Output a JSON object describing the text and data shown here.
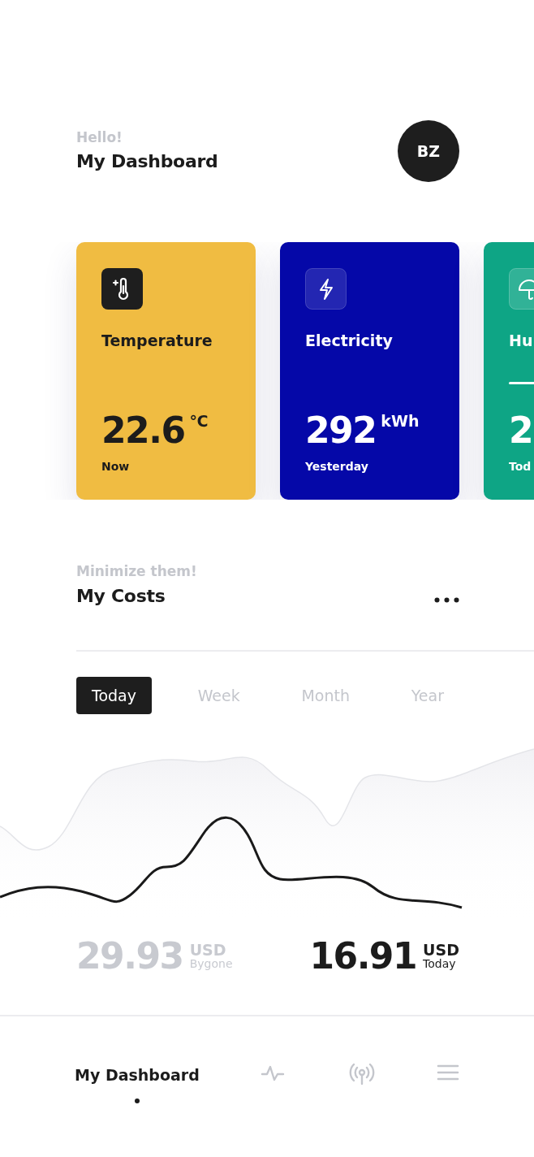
{
  "header": {
    "greeting": "Hello!",
    "title": "My Dashboard",
    "avatar": "BZ"
  },
  "cards": [
    {
      "kind": "temperature",
      "title": "Temperature",
      "value": "22.6",
      "unit": "℃",
      "caption": "Now",
      "color": "#f0bc42"
    },
    {
      "kind": "electricity",
      "title": "Electricity",
      "value": "292",
      "unit": "kWh",
      "caption": "Yesterday",
      "color": "#0508a8"
    },
    {
      "kind": "humidity",
      "title": "Hu",
      "value": "2",
      "caption": "Tod",
      "color": "#0ea585"
    }
  ],
  "costs": {
    "subtitle": "Minimize them!",
    "title": "My Costs"
  },
  "periods": [
    {
      "label": "Today",
      "selected": true
    },
    {
      "label": "Week",
      "selected": false
    },
    {
      "label": "Month",
      "selected": false
    },
    {
      "label": "Year",
      "selected": false
    }
  ],
  "totals": [
    {
      "kind": "past",
      "value": "29.93",
      "currency": "USD",
      "caption": "Bygone"
    },
    {
      "kind": "current",
      "value": "16.91",
      "currency": "USD",
      "caption": "Today"
    }
  ],
  "nav": [
    {
      "kind": "text",
      "label": "My Dashboard",
      "selected": true
    },
    {
      "kind": "pulse",
      "selected": false
    },
    {
      "kind": "antenna",
      "selected": false
    },
    {
      "kind": "menu",
      "selected": false
    }
  ]
}
